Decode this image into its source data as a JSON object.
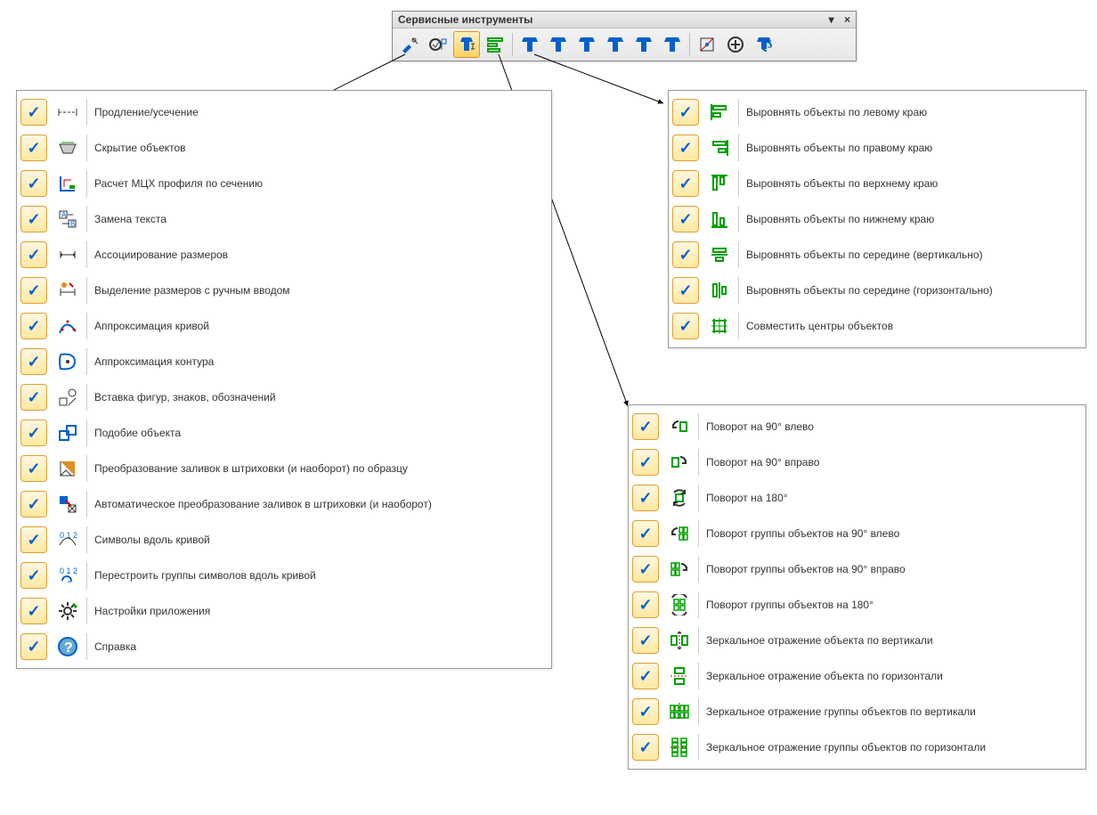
{
  "toolbar": {
    "title": "Сервисные инструменты",
    "buttons": [
      {
        "name": "tools-icon"
      },
      {
        "name": "stop-rebuild-icon"
      },
      {
        "name": "align-tool-icon",
        "active": true
      },
      {
        "name": "align-lines-icon"
      },
      {
        "name": "align-1"
      },
      {
        "name": "align-2"
      },
      {
        "name": "align-3"
      },
      {
        "name": "align-4"
      },
      {
        "name": "align-5"
      },
      {
        "name": "align-6"
      },
      {
        "name": "measure-icon"
      },
      {
        "name": "circle-plus-icon"
      },
      {
        "name": "refresh-icon"
      }
    ]
  },
  "panel_left": [
    {
      "label": "Продление/усечение",
      "icon": "extend-icon"
    },
    {
      "label": "Скрытие объектов",
      "icon": "hide-icon"
    },
    {
      "label": "Расчет МЦХ профиля по сечению",
      "icon": "profile-calc-icon"
    },
    {
      "label": "Замена текста",
      "icon": "replace-text-icon"
    },
    {
      "label": "Ассоциирование размеров",
      "icon": "assoc-dim-icon"
    },
    {
      "label": "Выделение размеров с ручным вводом",
      "icon": "manual-dim-icon"
    },
    {
      "label": "Аппроксимация кривой",
      "icon": "approx-curve-icon"
    },
    {
      "label": "Аппроксимация контура",
      "icon": "approx-contour-icon"
    },
    {
      "label": "Вставка фигур, знаков, обозначений",
      "icon": "insert-shapes-icon"
    },
    {
      "label": "Подобие объекта",
      "icon": "similar-icon"
    },
    {
      "label": "Преобразование заливок в штриховки (и наоборот) по образцу",
      "icon": "fill-convert-icon"
    },
    {
      "label": "Автоматическое преобразование заливок в штриховки (и наоборот)",
      "icon": "auto-fill-convert-icon"
    },
    {
      "label": "Символы вдоль кривой",
      "icon": "symbols-curve-icon"
    },
    {
      "label": "Перестроить группы символов вдоль кривой",
      "icon": "rebuild-symbols-icon"
    },
    {
      "label": "Настройки приложения",
      "icon": "settings-icon"
    },
    {
      "label": "Справка",
      "icon": "help-icon"
    }
  ],
  "panel_align": [
    {
      "label": "Выровнять объекты по левому краю",
      "icon": "align-left-icon"
    },
    {
      "label": "Выровнять объекты по правому краю",
      "icon": "align-right-icon"
    },
    {
      "label": "Выровнять объекты по верхнему краю",
      "icon": "align-top-icon"
    },
    {
      "label": "Выровнять объекты по нижнему краю",
      "icon": "align-bottom-icon"
    },
    {
      "label": "Выровнять объекты по середине (вертикально)",
      "icon": "align-mid-v-icon"
    },
    {
      "label": "Выровнять объекты по середине (горизонтально)",
      "icon": "align-mid-h-icon"
    },
    {
      "label": "Совместить центры объектов",
      "icon": "center-match-icon"
    }
  ],
  "panel_rotate": [
    {
      "label": "Поворот на 90° влево",
      "icon": "rot-90-left-icon"
    },
    {
      "label": "Поворот на 90° вправо",
      "icon": "rot-90-right-icon"
    },
    {
      "label": "Поворот на 180°",
      "icon": "rot-180-icon"
    },
    {
      "label": "Поворот группы объектов на 90° влево",
      "icon": "rot-group-90-left-icon"
    },
    {
      "label": "Поворот группы объектов на 90° вправо",
      "icon": "rot-group-90-right-icon"
    },
    {
      "label": "Поворот группы объектов на 180°",
      "icon": "rot-group-180-icon"
    },
    {
      "label": "Зеркальное отражение объекта по вертикали",
      "icon": "mirror-v-icon"
    },
    {
      "label": "Зеркальное отражение объекта по горизонтали",
      "icon": "mirror-h-icon"
    },
    {
      "label": "Зеркальное отражение группы объектов по вертикали",
      "icon": "mirror-group-v-icon"
    },
    {
      "label": "Зеркальное отражение группы объектов по горизонтали",
      "icon": "mirror-group-h-icon"
    }
  ]
}
